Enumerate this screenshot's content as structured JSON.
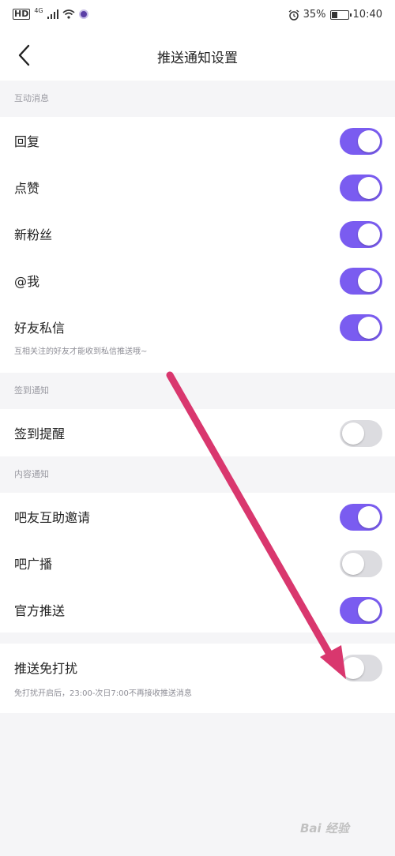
{
  "status_bar": {
    "hd": "HD",
    "network": "4G",
    "battery": "35%",
    "battery_level": 0.35,
    "time": "10:40",
    "icons": [
      "signal-icon",
      "wifi-icon",
      "app-dot-icon",
      "alarm-icon",
      "battery-icon"
    ]
  },
  "nav": {
    "title": "推送通知设置",
    "back_icon": "chevron-left-icon"
  },
  "sections": {
    "interaction": {
      "header": "互动消息",
      "items": [
        {
          "label": "回复",
          "on": true
        },
        {
          "label": "点赞",
          "on": true
        },
        {
          "label": "新粉丝",
          "on": true
        },
        {
          "label": "@我",
          "on": true
        },
        {
          "label": "好友私信",
          "on": true,
          "sub": "互相关注的好友才能收到私信推送哦~"
        }
      ]
    },
    "signin": {
      "header": "签到通知",
      "items": [
        {
          "label": "签到提醒",
          "on": false
        }
      ]
    },
    "content": {
      "header": "内容通知",
      "items": [
        {
          "label": "吧友互助邀请",
          "on": true
        },
        {
          "label": "吧广播",
          "on": false
        },
        {
          "label": "官方推送",
          "on": true
        }
      ]
    },
    "dnd": {
      "items": [
        {
          "label": "推送免打扰",
          "on": false,
          "sub": "免打扰开启后，23:00-次日7:00不再接收推送消息"
        }
      ]
    }
  },
  "colors": {
    "toggle_on": "#7a5cf0",
    "toggle_off": "#dcdce0",
    "annotation_arrow": "#d9376e"
  },
  "watermark": "Bai 经验"
}
